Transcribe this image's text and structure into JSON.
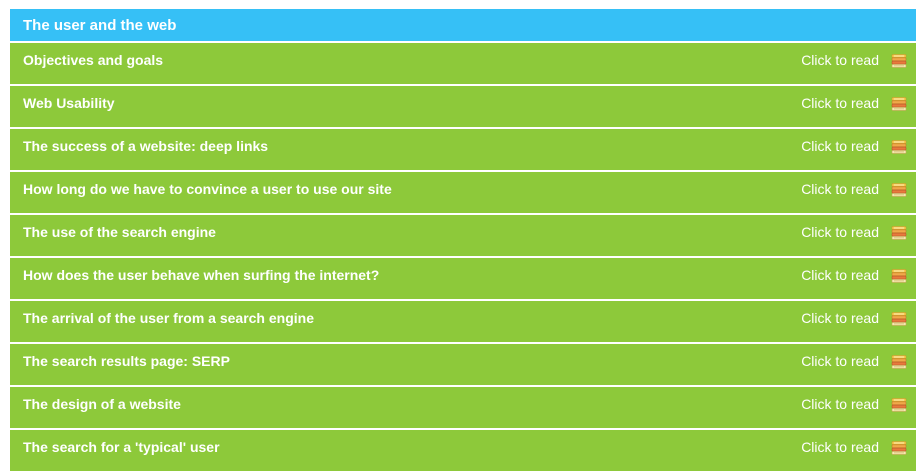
{
  "panel": {
    "title": "The user and the web",
    "header_color": "#36c0f6",
    "row_color": "#8dc93a"
  },
  "rows": [
    {
      "title": "Objectives and goals",
      "action": "Click to read",
      "icon": "book-stack-icon"
    },
    {
      "title": "Web Usability",
      "action": "Click to read",
      "icon": "book-stack-icon"
    },
    {
      "title": "The success of a website: deep links",
      "action": "Click to read",
      "icon": "book-stack-icon"
    },
    {
      "title": "How long do we have to convince a user to use our site",
      "action": "Click to read",
      "icon": "book-stack-icon"
    },
    {
      "title": "The use of the search engine",
      "action": "Click to read",
      "icon": "book-stack-icon"
    },
    {
      "title": "How does the user behave when surfing the internet?",
      "action": "Click to read",
      "icon": "book-stack-icon"
    },
    {
      "title": "The arrival of the user from a search engine",
      "action": "Click to read",
      "icon": "book-stack-icon"
    },
    {
      "title": "The search results page: SERP",
      "action": "Click to read",
      "icon": "book-stack-icon"
    },
    {
      "title": "The design of a website",
      "action": "Click to read",
      "icon": "book-stack-icon"
    },
    {
      "title": "The search for a 'typical' user",
      "action": "Click to read",
      "icon": "book-stack-icon"
    }
  ]
}
